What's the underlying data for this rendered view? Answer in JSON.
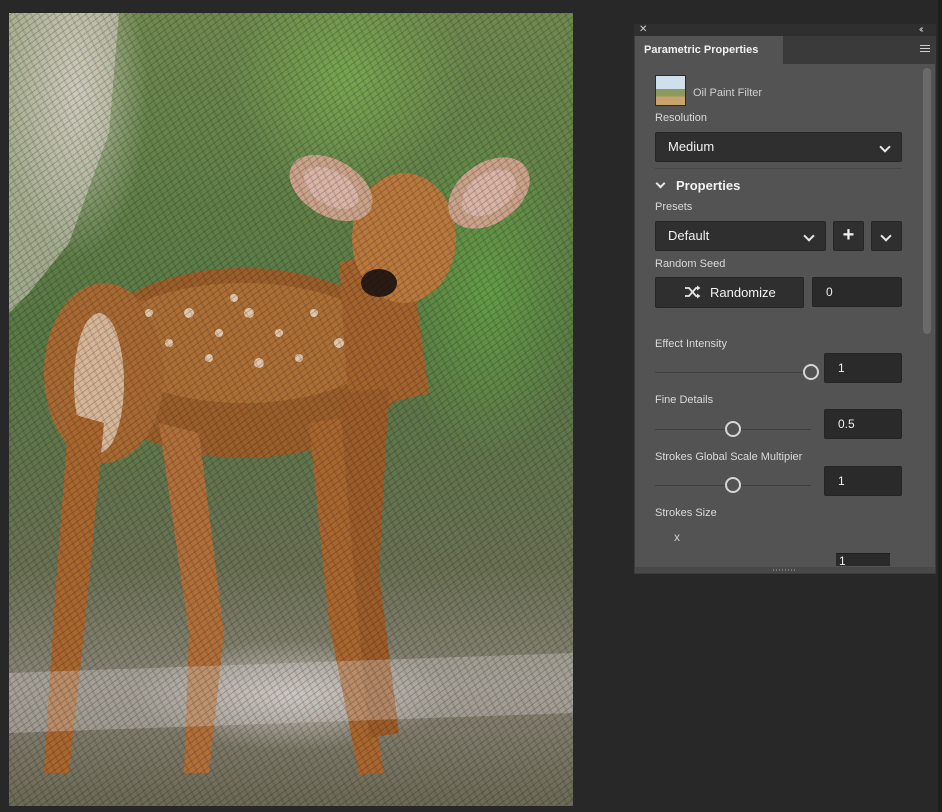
{
  "panel": {
    "tab_title": "Parametric Properties",
    "filter_name": "Oil Paint Filter",
    "resolution": {
      "label": "Resolution",
      "value": "Medium"
    },
    "properties_section": "Properties",
    "presets": {
      "label": "Presets",
      "value": "Default"
    },
    "random_seed": {
      "label": "Random Seed",
      "button": "Randomize",
      "value": "0"
    },
    "sliders": [
      {
        "label": "Effect Intensity",
        "value": "1",
        "fraction": 1.0
      },
      {
        "label": "Fine Details",
        "value": "0.5",
        "fraction": 0.5
      },
      {
        "label": "Strokes Global Scale Multipier",
        "value": "1",
        "fraction": 0.5
      }
    ],
    "strokes_size": {
      "label": "Strokes Size",
      "axis_label": "x",
      "value": "1"
    }
  },
  "icons": {
    "close": "close-icon",
    "collapse": "double-chevron-icon",
    "menu": "panel-menu-icon",
    "randomize": "shuffle-icon"
  },
  "colors": {
    "panel_bg": "#535353",
    "workspace_bg": "#282828",
    "field_bg": "#2f2f2f"
  }
}
